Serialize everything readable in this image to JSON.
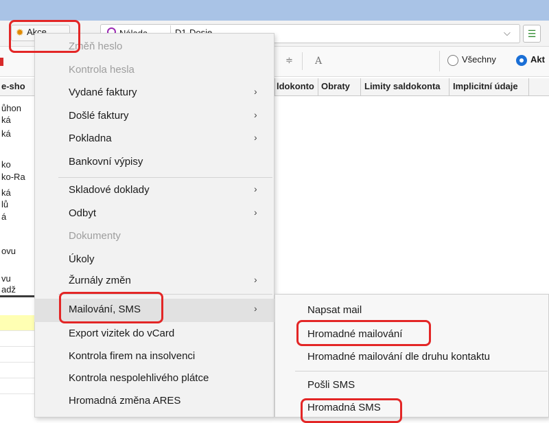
{
  "toolbar": {
    "akce_label": "Akce",
    "combo_left": "Nálada",
    "combo_right": "D1-Dosie",
    "radio_all": "Všechny",
    "radio_active": "Akt"
  },
  "grid": {
    "headers": [
      "e-sho",
      "ldokonto",
      "Obraty",
      "Limity saldokonta",
      "Implicitní údaje"
    ],
    "left_cells": [
      "ůhon",
      "ká",
      "ká",
      "ko",
      "ko-Ra",
      "ká",
      "lů",
      "á",
      "ovu",
      "vu",
      "adž"
    ]
  },
  "menu": {
    "items": [
      {
        "label": "Změň heslo",
        "disabled": true,
        "submenu": false
      },
      {
        "label": "Kontrola hesla",
        "disabled": true,
        "submenu": false
      },
      {
        "label": "Vydané faktury",
        "disabled": false,
        "submenu": true
      },
      {
        "label": "Došlé faktury",
        "disabled": false,
        "submenu": true
      },
      {
        "label": "Pokladna",
        "disabled": false,
        "submenu": true
      },
      {
        "label": "Bankovní výpisy",
        "disabled": false,
        "submenu": false
      },
      {
        "label": "Skladové doklady",
        "disabled": false,
        "submenu": true
      },
      {
        "label": "Odbyt",
        "disabled": false,
        "submenu": true
      },
      {
        "label": "Dokumenty",
        "disabled": true,
        "submenu": false
      },
      {
        "label": "Úkoly",
        "disabled": false,
        "submenu": false
      },
      {
        "label": "Žurnály změn",
        "disabled": false,
        "submenu": true
      },
      {
        "label": "Mailování, SMS",
        "disabled": false,
        "submenu": true,
        "highlighted": true
      },
      {
        "label": "Export vizitek do vCard",
        "disabled": false,
        "submenu": false
      },
      {
        "label": "Kontrola firem na insolvenci",
        "disabled": false,
        "submenu": false
      },
      {
        "label": "Kontrola nespolehlivého plátce",
        "disabled": false,
        "submenu": false
      },
      {
        "label": "Hromadná změna ARES",
        "disabled": false,
        "submenu": false
      }
    ],
    "arrow": "›"
  },
  "submenu": {
    "items": [
      {
        "label": "Napsat mail"
      },
      {
        "label": "Hromadné mailování"
      },
      {
        "label": "Hromadné mailování dle druhu kontaktu"
      },
      {
        "label": "Pošli SMS"
      },
      {
        "label": "Hromadná SMS"
      }
    ]
  },
  "colors": {
    "annotation": "#e32626",
    "radio_accent": "#1a6fd6",
    "top_strip": "#a9c3e6"
  }
}
